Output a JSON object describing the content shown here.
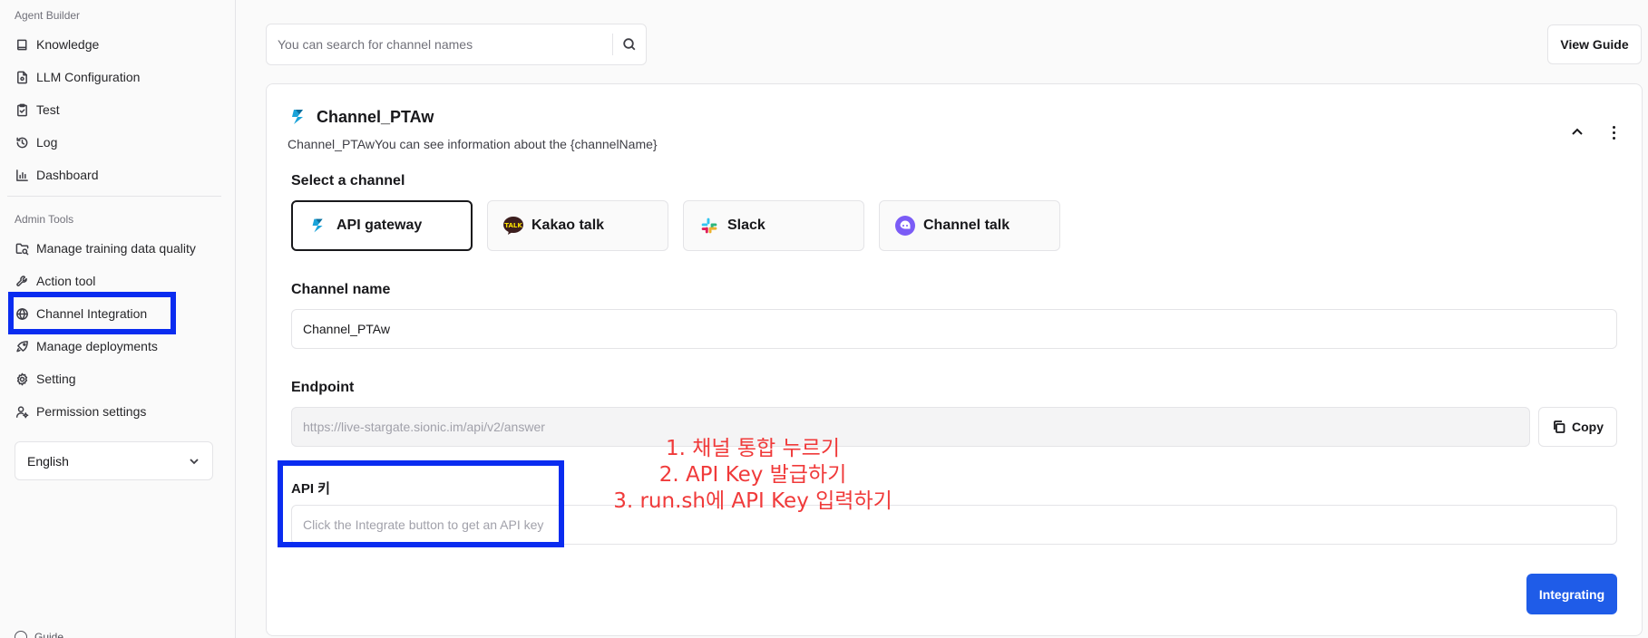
{
  "sidebar": {
    "section_agent_builder": "Agent Builder",
    "section_admin_tools": "Admin Tools",
    "items": [
      {
        "label": "Knowledge",
        "icon": "book-icon"
      },
      {
        "label": "LLM Configuration",
        "icon": "file-settings-icon"
      },
      {
        "label": "Test",
        "icon": "clipboard-check-icon"
      },
      {
        "label": "Log",
        "icon": "history-icon"
      },
      {
        "label": "Dashboard",
        "icon": "bar-chart-icon"
      },
      {
        "label": "Manage training data quality",
        "icon": "folder-search-icon"
      },
      {
        "label": "Action tool",
        "icon": "wrench-icon"
      },
      {
        "label": "Channel Integration",
        "icon": "globe-icon"
      },
      {
        "label": "Manage deployments",
        "icon": "rocket-icon"
      },
      {
        "label": "Setting",
        "icon": "gear-icon"
      },
      {
        "label": "Permission settings",
        "icon": "user-settings-icon"
      }
    ],
    "language": "English",
    "bottom_label": "Guide"
  },
  "header": {
    "search_placeholder": "You can search for channel names",
    "view_guide_label": "View Guide"
  },
  "channel": {
    "title": "Channel_PTAw",
    "description": "Channel_PTAwYou can see information about the {channelName}",
    "select_label": "Select a channel",
    "options": [
      {
        "label": "API gateway",
        "selected": true
      },
      {
        "label": "Kakao talk",
        "selected": false
      },
      {
        "label": "Slack",
        "selected": false
      },
      {
        "label": "Channel talk",
        "selected": false
      }
    ],
    "name_label": "Channel name",
    "name_value": "Channel_PTAw",
    "endpoint_label": "Endpoint",
    "endpoint_value": "https://live-stargate.sionic.im/api/v2/answer",
    "copy_label": "Copy",
    "api_key_label": "API 키",
    "api_key_placeholder": "Click the Integrate button to get an API key",
    "integrate_label": "Integrating"
  },
  "annotation": {
    "lines": [
      "1. 채널 통합 누르기",
      "2. API Key 발급하기",
      "3. run.sh에 API Key 입력하기"
    ]
  },
  "colors": {
    "highlight": "#0a2cf0",
    "annotation": "#f03a3a",
    "primary": "#1f5ce8"
  }
}
